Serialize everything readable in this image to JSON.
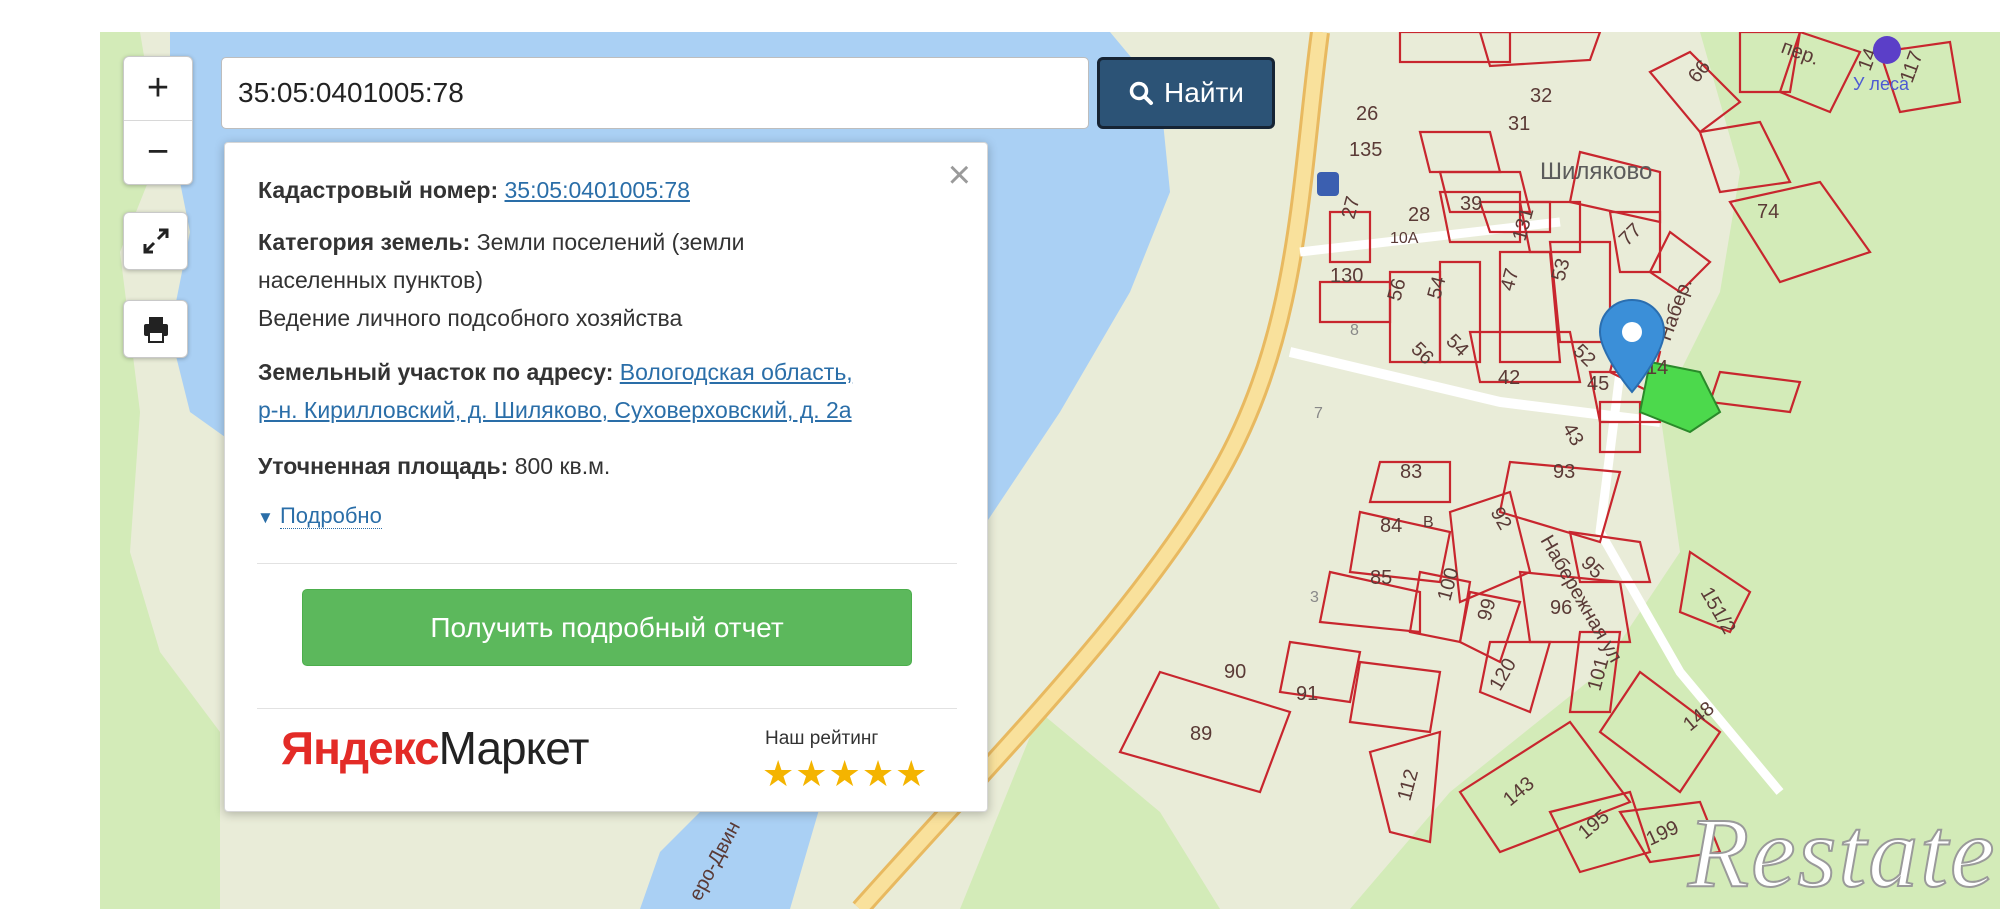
{
  "search": {
    "value": "35:05:0401005:78",
    "button_label": "Найти"
  },
  "controls": {
    "zoom_in": "+",
    "zoom_out": "−"
  },
  "info": {
    "cadastral_label": "Кадастровый номер:",
    "cadastral_value": "35:05:0401005:78",
    "category_label": "Категория земель:",
    "category_value": "Земли поселений (земли",
    "category_value_2": "населенных пунктов)",
    "usage": "Ведение личного подсобного хозяйства",
    "address_label": "Земельный участок по адресу:",
    "address_line_1": "Вологодская область,",
    "address_line_2": "р-н. Кирилловский, д. Шиляково, Суховерховский, д. 2а",
    "area_label": "Уточненная площадь:",
    "area_value": "800 кв.м.",
    "more_label": "Подробно",
    "report_button": "Получить подробный отчет",
    "market_logo_a": "Яндекс",
    "market_logo_b": "Маркет",
    "rating_label": "Наш рейтинг",
    "rating_stars": 5,
    "rating_text": "★★★★★"
  },
  "map": {
    "village": "Шиляково",
    "poi_u_lesa": "У леса",
    "street_naberezhnaya": "Набережная ул",
    "street_naberezhnaya_short": "Набер.",
    "street_per": "пер.",
    "river_label": "еро-Двин",
    "parcels": [
      "26",
      "32",
      "31",
      "135",
      "66",
      "74",
      "27",
      "28",
      "10А",
      "39",
      "131",
      "77",
      "130",
      "56",
      "54",
      "47",
      "53",
      "14",
      "8",
      "56",
      "54",
      "52",
      "42",
      "45",
      "7",
      "43",
      "83",
      "93",
      "84",
      "92",
      "95",
      "151/2",
      "85",
      "100",
      "99",
      "96",
      "3",
      "120",
      "101",
      "90",
      "91",
      "148",
      "89",
      "112",
      "143",
      "195",
      "199",
      "117",
      "14",
      "В"
    ],
    "watermark": "Restate",
    "colors": {
      "parcel": "#c8262e",
      "selected_parcel": "#3cd43c",
      "water": "#aacff5",
      "land": "#e8ecd6",
      "forest": "#d0ebb5",
      "road": "#f7d98a",
      "marker": "#3b8fd8"
    }
  }
}
